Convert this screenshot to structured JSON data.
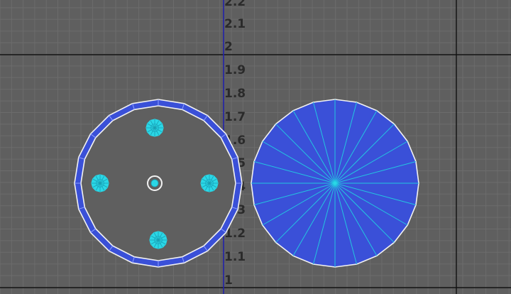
{
  "viewport": {
    "v_axis_labels": [
      "2.2",
      "2.1",
      "2",
      "1.9",
      "1.8",
      "1.7",
      "1.6",
      "1.5",
      "1.4",
      "1.3",
      "1.2",
      "1.1",
      "1"
    ]
  },
  "colors": {
    "background": "#5f5f5f",
    "grid_minor": "#6c6c6c",
    "grid_major": "#111111",
    "axis": "#2222aa",
    "face_fill": "#3a50d8",
    "wire_white": "#f2f2f2",
    "vertex_cyan": "#2ad7e6",
    "spoke_cyan": "#23c6e0"
  },
  "objects": {
    "left": {
      "name": "ring-circle-with-holes",
      "outer_ring_segments": 20,
      "holes": 4
    },
    "right": {
      "name": "filled-disc-fan",
      "segments": 24
    }
  }
}
